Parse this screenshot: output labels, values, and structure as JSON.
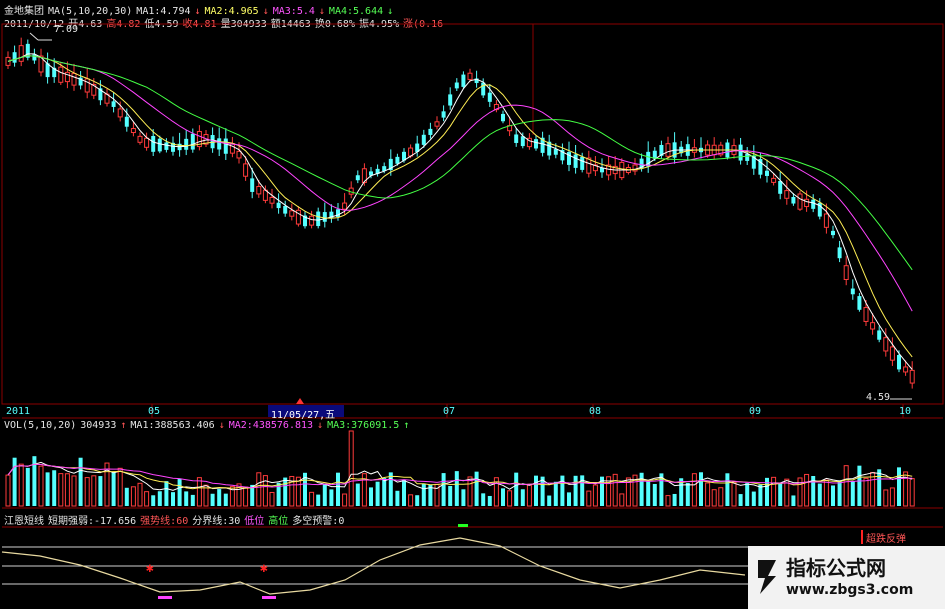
{
  "stock": {
    "name": "金地集团"
  },
  "ma_header": {
    "label": "MA(5,10,20,30)",
    "ma1": "MA1:4.794",
    "ma2": "MA2:4.965",
    "ma3": "MA3:5.4",
    "ma4": "MA4:5.644"
  },
  "quote": {
    "date": "2011/10/12",
    "open": "开4.63",
    "high": "高4.82",
    "low": "低4.59",
    "close": "收4.81",
    "volume": "量304933",
    "amount": "额14463",
    "turnover": "换0.68%",
    "amplitude": "振4.95%",
    "change": "涨(0.16"
  },
  "price_marks": {
    "top": "7.09",
    "bottom": "4.59"
  },
  "time_axis": {
    "labels": [
      "2011",
      "05",
      "07",
      "08",
      "09",
      "10"
    ],
    "cursor_date": "11/05/27,五"
  },
  "vol_header": {
    "label": "VOL(5,10,20)",
    "value": "304933",
    "ma1": "MA1:388563.406",
    "ma2": "MA2:438576.813",
    "ma3": "MA3:376091.5"
  },
  "indicator_header": {
    "name": "江恩短线",
    "short_strength": "短期强弱:-17.656",
    "strong_line": "强势线:60",
    "divider_line": "分界线:30",
    "low_level": "低位",
    "high_level": "高位",
    "signal": "多空预警:0"
  },
  "indicator_side_label": "超跌反弹",
  "watermark": {
    "title": "指标公式网",
    "url": "www.zbgs3.com"
  },
  "colors": {
    "up": "#ff3b3b",
    "down": "#55ffff",
    "ma5": "#ffffff",
    "ma10": "#ffee55",
    "ma20": "#ff44ff",
    "ma30": "#44ff44",
    "grid": "#8b0000"
  },
  "chart_data": {
    "type": "candlestick",
    "series_names": [
      "MA1",
      "MA2",
      "MA3",
      "MA4"
    ],
    "price_high": 7.09,
    "price_low": 4.59,
    "indicator_levels": {
      "strong_line": 60,
      "divider_line": 30
    }
  }
}
